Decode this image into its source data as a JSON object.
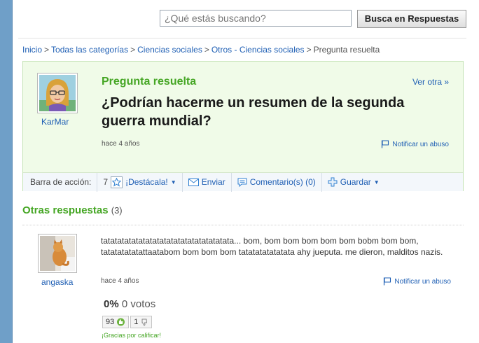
{
  "search": {
    "placeholder": "¿Qué estás buscando?",
    "button_label": "Busca en Respuestas"
  },
  "breadcrumb": {
    "items": [
      "Inicio",
      "Todas las categorías",
      "Ciencias sociales",
      "Otros - Ciencias sociales"
    ],
    "current": "Pregunta resuelta",
    "separator": ">"
  },
  "question": {
    "status": "Pregunta resuelta",
    "see_other": "Ver otra »",
    "title": "¿Podrían hacerme un resumen de la segunda guerra mundial?",
    "author": "KarMar",
    "time": "hace 4 años",
    "report": "Notificar un abuso"
  },
  "action_bar": {
    "label": "Barra de acción:",
    "star_count": "7",
    "highlight": "¡Destácala!",
    "send": "Enviar",
    "comments": "Comentario(s) (0)",
    "save": "Guardar"
  },
  "answers": {
    "heading": "Otras respuestas",
    "count": "(3)",
    "items": [
      {
        "author": "angaska",
        "text": "tatatatatatatatatatatatatatatatatatata... bom, bom bom bom bom bom bobm bom bom, tatatatatatattaatabom bom bom bom tatatatatatatata ahy jueputa. me dieron, malditos nazis.",
        "time": "hace 4 años",
        "report": "Notificar un abuso",
        "percent": "0%",
        "votes": "0 votos",
        "thumbs_up": "93",
        "thumbs_down": "1",
        "thanks": "¡Gracias por calificar!"
      }
    ]
  },
  "colors": {
    "accent_green": "#45a624",
    "link_blue": "#1f5fb4",
    "question_bg": "#f0fbe8",
    "sidebar_blue": "#6f9fc8"
  }
}
